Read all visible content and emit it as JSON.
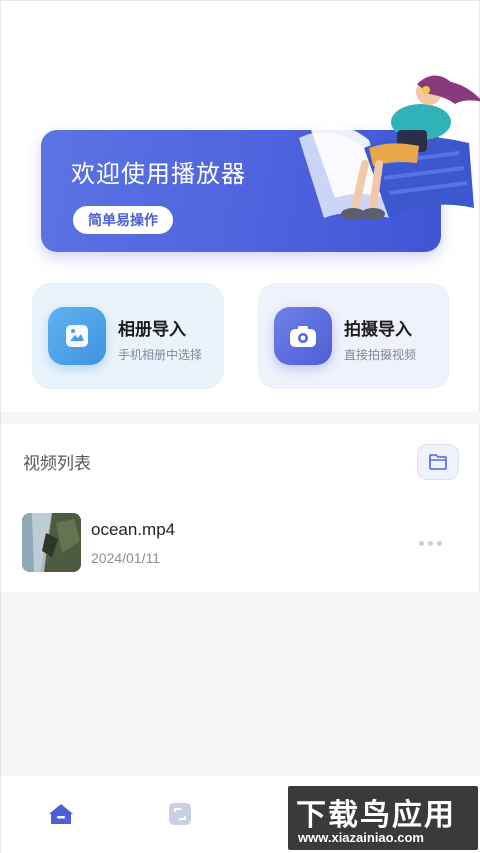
{
  "banner": {
    "title": "欢迎使用播放器",
    "button_label": "简单易操作"
  },
  "import_cards": [
    {
      "title": "相册导入",
      "subtitle": "手机相册中选择",
      "icon": "image-icon",
      "color": "#4a9ee6"
    },
    {
      "title": "拍摄导入",
      "subtitle": "直接拍摄视频",
      "icon": "camera-icon",
      "color": "#5465d9"
    }
  ],
  "video_list": {
    "title": "视频列表",
    "folder_icon": "folder-icon",
    "items": [
      {
        "name": "ocean.mp4",
        "date": "2024/01/11"
      }
    ]
  },
  "tabbar": {
    "tabs": [
      {
        "icon": "home-icon",
        "active": true
      },
      {
        "icon": "convert-icon",
        "active": false
      }
    ]
  },
  "watermark": {
    "main": "下载鸟应用",
    "url": "www.xiazainiao.com"
  },
  "colors": {
    "accent": "#4f63de",
    "banner_start": "#5b74e3",
    "banner_end": "#3f55d6"
  }
}
